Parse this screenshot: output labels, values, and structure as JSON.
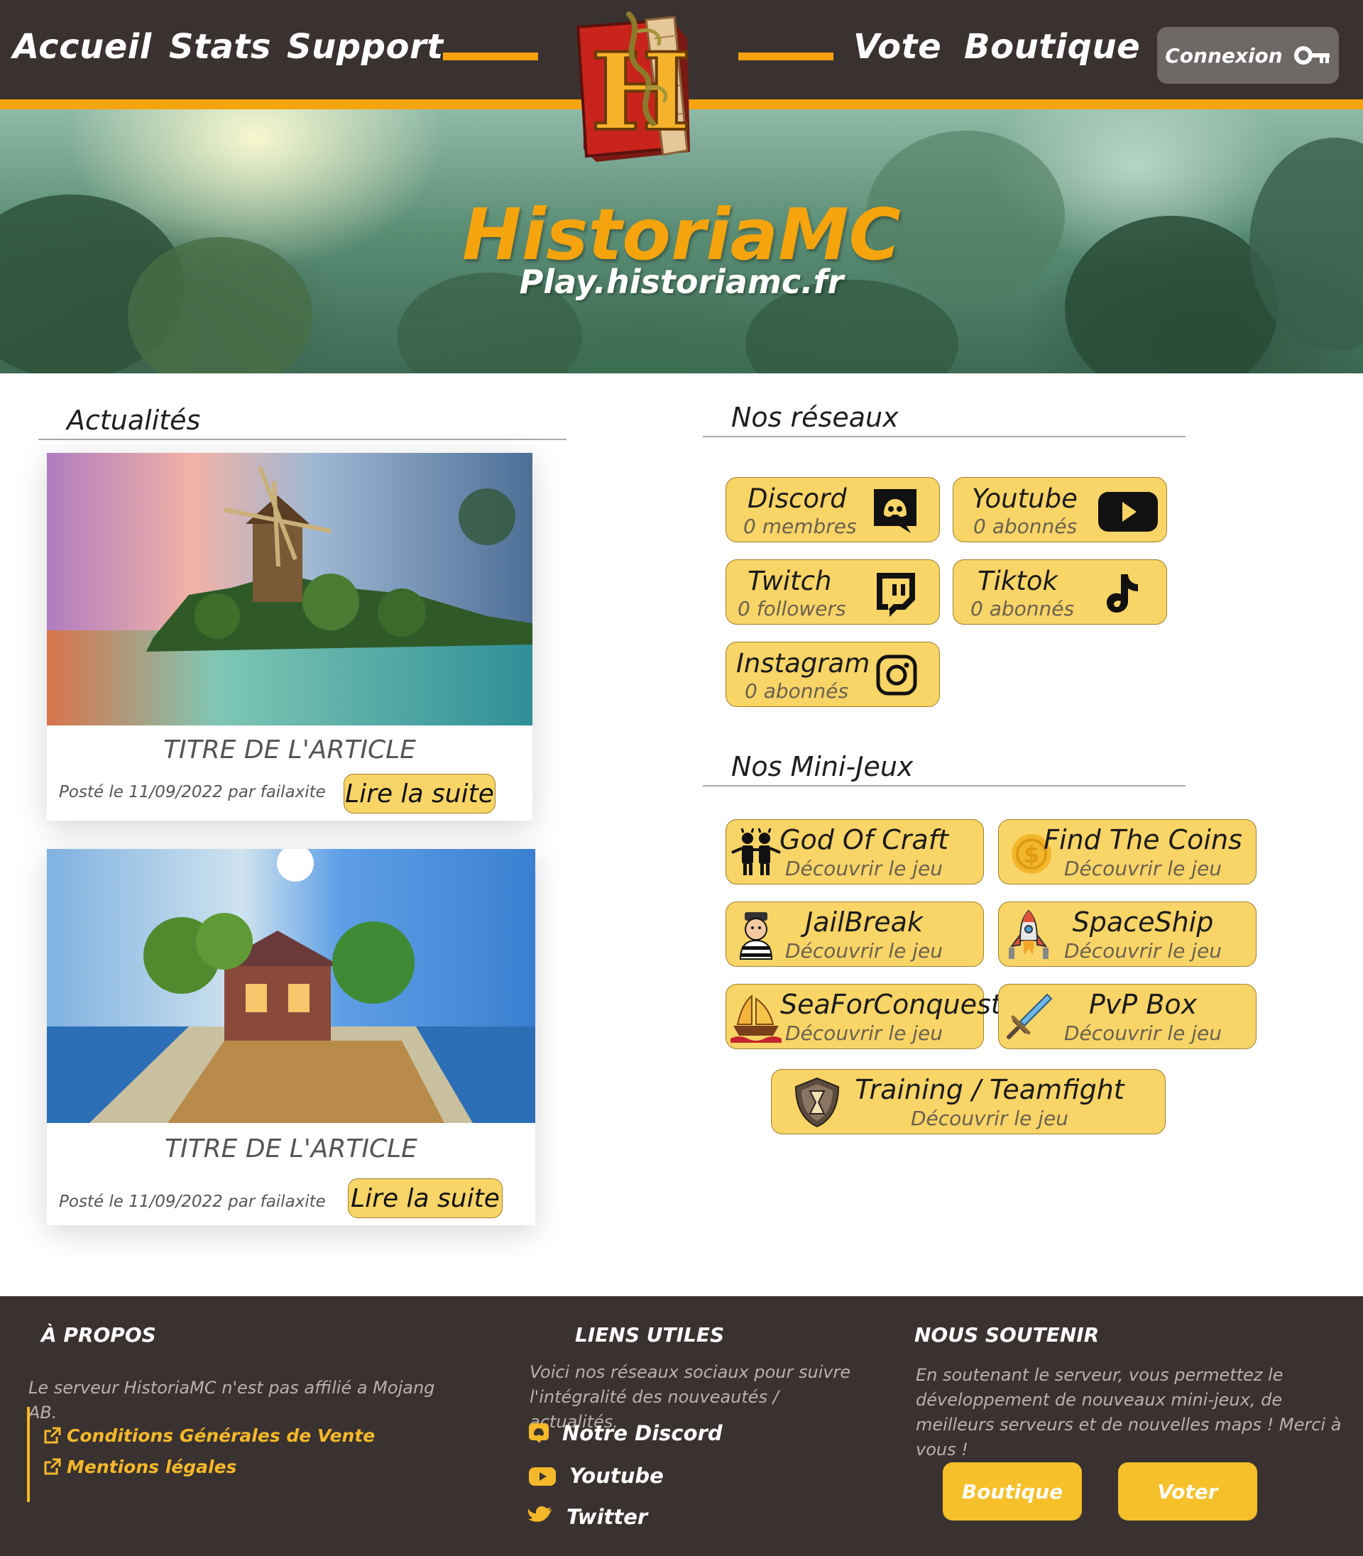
{
  "nav": {
    "items": [
      "Accueil",
      "Stats",
      "Support",
      "Vote",
      "Boutique"
    ],
    "login_label": "Connexion"
  },
  "hero": {
    "title": "HistoriaMC",
    "subtitle": "Play.historiamc.fr"
  },
  "news": {
    "heading": "Actualités",
    "articles": [
      {
        "title": "TITRE DE L'ARTICLE",
        "meta": "Posté le 11/09/2022 par failaxite",
        "button": "Lire la suite"
      },
      {
        "title": "TITRE DE L'ARTICLE",
        "meta": "Posté le 11/09/2022 par failaxite",
        "button": "Lire la suite"
      }
    ]
  },
  "networks": {
    "heading": "Nos réseaux",
    "items": [
      {
        "name": "Discord",
        "count": "0 membres",
        "icon": "discord-icon"
      },
      {
        "name": "Youtube",
        "count": "0 abonnés",
        "icon": "youtube-icon"
      },
      {
        "name": "Twitch",
        "count": "0 followers",
        "icon": "twitch-icon"
      },
      {
        "name": "Tiktok",
        "count": "0 abonnés",
        "icon": "tiktok-icon"
      },
      {
        "name": "Instagram",
        "count": "0 abonnés",
        "icon": "instagram-icon"
      }
    ]
  },
  "minigames": {
    "heading": "Nos Mini-Jeux",
    "cta": "Découvrir le jeu",
    "items": [
      {
        "name": "God Of Craft",
        "icon": "heroes-icon"
      },
      {
        "name": "Find The Coins",
        "icon": "coin-icon"
      },
      {
        "name": "JailBreak",
        "icon": "prisoner-icon"
      },
      {
        "name": "SpaceShip",
        "icon": "rocket-icon"
      },
      {
        "name": "SeaForConquest",
        "icon": "ship-icon"
      },
      {
        "name": "PvP Box",
        "icon": "sword-icon"
      },
      {
        "name": "Training / Teamfight",
        "icon": "shield-hourglass-icon"
      }
    ]
  },
  "footer": {
    "about": {
      "heading": "À PROPOS",
      "text": "Le serveur HistoriaMC n'est pas affilié a Mojang AB.",
      "links": [
        "Conditions Générales de Vente",
        "Mentions légales"
      ]
    },
    "useful": {
      "heading": "LIENS UTILES",
      "text": "Voici nos réseaux sociaux pour suivre l'intégralité des nouveautés / actualités.",
      "links": [
        "Notre Discord",
        "Youtube",
        "Twitter"
      ]
    },
    "support": {
      "heading": "NOUS SOUTENIR",
      "text": "En soutenant le serveur, vous permettez le développement de nouveaux mini-jeux, de meilleurs serveurs et de nouvelles maps ! Merci à vous !",
      "buttons": [
        "Boutique",
        "Voter"
      ]
    }
  },
  "colors": {
    "accent": "#f5a40d",
    "card": "#f9d466",
    "dark": "#3a3230",
    "footer_link": "#f5b82a"
  }
}
